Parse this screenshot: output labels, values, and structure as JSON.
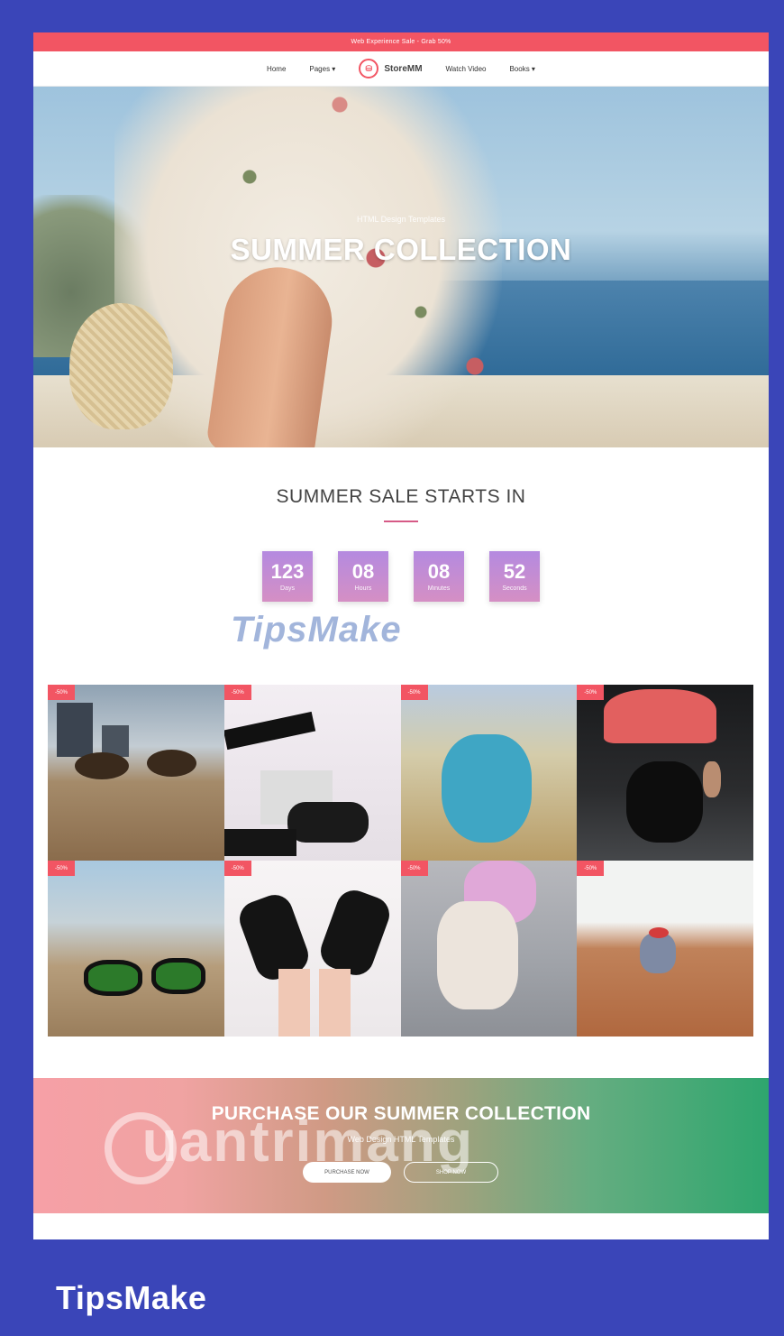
{
  "topbar": {
    "text": "Web Experience Sale - Grab 50%"
  },
  "nav": {
    "items": [
      {
        "label": "Home"
      },
      {
        "label": "Pages ▾"
      },
      {
        "label": "Watch Video"
      },
      {
        "label": "Books ▾"
      }
    ],
    "logo_text": "StoreMM"
  },
  "hero": {
    "subtitle": "HTML Design Templates",
    "title": "SUMMER COLLECTION"
  },
  "countdown": {
    "heading": "SUMMER SALE STARTS IN",
    "boxes": [
      {
        "value": "123",
        "label": "Days"
      },
      {
        "value": "08",
        "label": "Hours"
      },
      {
        "value": "08",
        "label": "Minutes"
      },
      {
        "value": "52",
        "label": "Seconds"
      }
    ]
  },
  "gallery": {
    "badges": [
      "-50%",
      "-50%",
      "-50%",
      "-50%",
      "-50%",
      "-50%",
      "-50%",
      "-50%"
    ]
  },
  "promo": {
    "title": "PURCHASE OUR SUMMER COLLECTION",
    "subtitle": "Web Design HTML Templates",
    "button_primary": "PURCHASE NOW",
    "button_secondary": "SHOP NOW"
  },
  "watermarks": {
    "tipsmake": "TipsMake",
    "quantrimang": "uantrimang"
  },
  "brand": {
    "label": "TipsMake"
  },
  "colors": {
    "accent": "#f25563",
    "frame": "#3a45b8"
  }
}
